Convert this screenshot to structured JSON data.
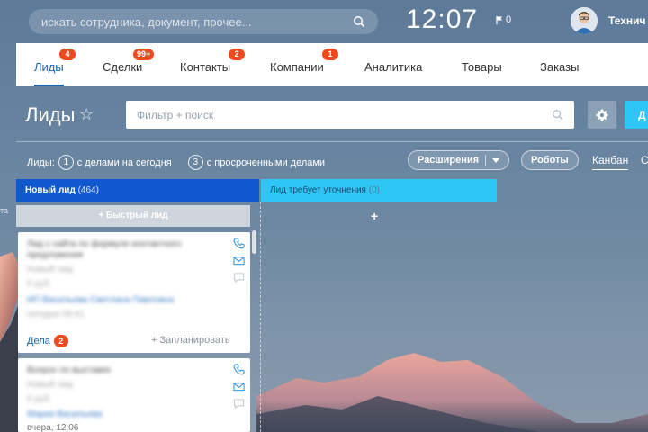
{
  "topbar": {
    "search_placeholder": "искать сотрудника, документ, прочее...",
    "clock": "12:07",
    "notifications_count": "0",
    "user_name": "Технич"
  },
  "tabs": [
    {
      "label": "Лиды",
      "badge": "4",
      "active": true
    },
    {
      "label": "Сделки",
      "badge": "99+"
    },
    {
      "label": "Контакты",
      "badge": "2"
    },
    {
      "label": "Компании",
      "badge": "1"
    },
    {
      "label": "Аналитика"
    },
    {
      "label": "Товары"
    },
    {
      "label": "Заказы"
    }
  ],
  "header": {
    "title": "Лиды",
    "filter_placeholder": "Фильтр + поиск",
    "add_button": "Д"
  },
  "counters": {
    "prefix": "Лиды:",
    "today_count": "1",
    "today_label": "с делами на сегодня",
    "overdue_count": "3",
    "overdue_label": "с просроченными делами"
  },
  "toolbar": {
    "extensions": "Расширения",
    "robots": "Роботы",
    "view_kanban": "Канбан",
    "view_other": "С"
  },
  "kanban": {
    "columns": [
      {
        "title": "Новый лид",
        "count": "(464)"
      },
      {
        "title": "Лид требует уточнения",
        "count": "(0)"
      }
    ],
    "quick_add": "Быстрый лид",
    "col2_add": "+",
    "side_label": "та"
  },
  "cards": [
    {
      "lines": [
        "Лид с сайта по формуле контактного",
        "предложения",
        "Новый лид",
        "0 руб.",
        "ИП Васильева Светлана Павловна",
        "сегодня 09:41"
      ],
      "deals_label": "Дела",
      "deals_count": "2",
      "plan_label": "+ Запланировать"
    },
    {
      "lines": [
        "Вопрос по выставке",
        "Новый лид",
        "0 руб.",
        "Мария Васильева"
      ],
      "date": "вчера, 12:06"
    }
  ]
}
